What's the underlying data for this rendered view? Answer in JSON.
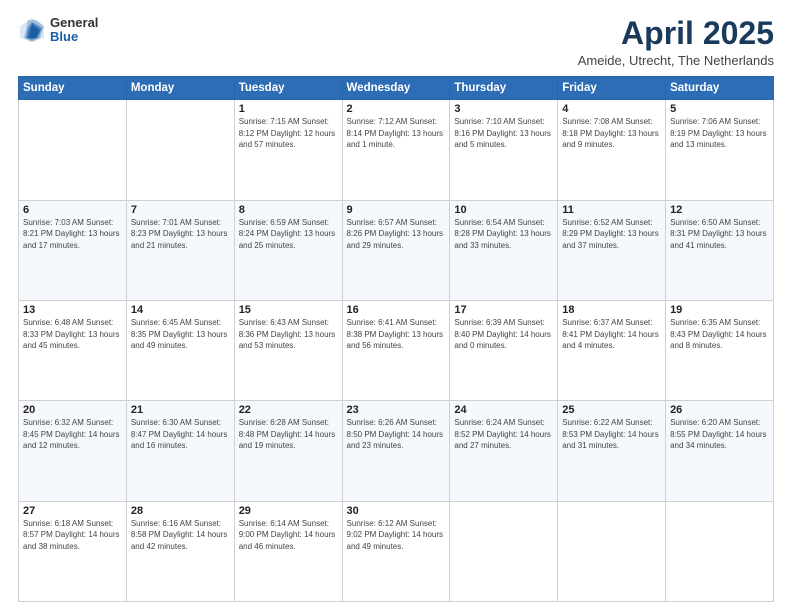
{
  "header": {
    "logo": {
      "general": "General",
      "blue": "Blue"
    },
    "title": "April 2025",
    "location": "Ameide, Utrecht, The Netherlands"
  },
  "days_of_week": [
    "Sunday",
    "Monday",
    "Tuesday",
    "Wednesday",
    "Thursday",
    "Friday",
    "Saturday"
  ],
  "weeks": [
    [
      {
        "day": "",
        "info": ""
      },
      {
        "day": "",
        "info": ""
      },
      {
        "day": "1",
        "info": "Sunrise: 7:15 AM\nSunset: 8:12 PM\nDaylight: 12 hours and 57 minutes."
      },
      {
        "day": "2",
        "info": "Sunrise: 7:12 AM\nSunset: 8:14 PM\nDaylight: 13 hours and 1 minute."
      },
      {
        "day": "3",
        "info": "Sunrise: 7:10 AM\nSunset: 8:16 PM\nDaylight: 13 hours and 5 minutes."
      },
      {
        "day": "4",
        "info": "Sunrise: 7:08 AM\nSunset: 8:18 PM\nDaylight: 13 hours and 9 minutes."
      },
      {
        "day": "5",
        "info": "Sunrise: 7:06 AM\nSunset: 8:19 PM\nDaylight: 13 hours and 13 minutes."
      }
    ],
    [
      {
        "day": "6",
        "info": "Sunrise: 7:03 AM\nSunset: 8:21 PM\nDaylight: 13 hours and 17 minutes."
      },
      {
        "day": "7",
        "info": "Sunrise: 7:01 AM\nSunset: 8:23 PM\nDaylight: 13 hours and 21 minutes."
      },
      {
        "day": "8",
        "info": "Sunrise: 6:59 AM\nSunset: 8:24 PM\nDaylight: 13 hours and 25 minutes."
      },
      {
        "day": "9",
        "info": "Sunrise: 6:57 AM\nSunset: 8:26 PM\nDaylight: 13 hours and 29 minutes."
      },
      {
        "day": "10",
        "info": "Sunrise: 6:54 AM\nSunset: 8:28 PM\nDaylight: 13 hours and 33 minutes."
      },
      {
        "day": "11",
        "info": "Sunrise: 6:52 AM\nSunset: 8:29 PM\nDaylight: 13 hours and 37 minutes."
      },
      {
        "day": "12",
        "info": "Sunrise: 6:50 AM\nSunset: 8:31 PM\nDaylight: 13 hours and 41 minutes."
      }
    ],
    [
      {
        "day": "13",
        "info": "Sunrise: 6:48 AM\nSunset: 8:33 PM\nDaylight: 13 hours and 45 minutes."
      },
      {
        "day": "14",
        "info": "Sunrise: 6:45 AM\nSunset: 8:35 PM\nDaylight: 13 hours and 49 minutes."
      },
      {
        "day": "15",
        "info": "Sunrise: 6:43 AM\nSunset: 8:36 PM\nDaylight: 13 hours and 53 minutes."
      },
      {
        "day": "16",
        "info": "Sunrise: 6:41 AM\nSunset: 8:38 PM\nDaylight: 13 hours and 56 minutes."
      },
      {
        "day": "17",
        "info": "Sunrise: 6:39 AM\nSunset: 8:40 PM\nDaylight: 14 hours and 0 minutes."
      },
      {
        "day": "18",
        "info": "Sunrise: 6:37 AM\nSunset: 8:41 PM\nDaylight: 14 hours and 4 minutes."
      },
      {
        "day": "19",
        "info": "Sunrise: 6:35 AM\nSunset: 8:43 PM\nDaylight: 14 hours and 8 minutes."
      }
    ],
    [
      {
        "day": "20",
        "info": "Sunrise: 6:32 AM\nSunset: 8:45 PM\nDaylight: 14 hours and 12 minutes."
      },
      {
        "day": "21",
        "info": "Sunrise: 6:30 AM\nSunset: 8:47 PM\nDaylight: 14 hours and 16 minutes."
      },
      {
        "day": "22",
        "info": "Sunrise: 6:28 AM\nSunset: 8:48 PM\nDaylight: 14 hours and 19 minutes."
      },
      {
        "day": "23",
        "info": "Sunrise: 6:26 AM\nSunset: 8:50 PM\nDaylight: 14 hours and 23 minutes."
      },
      {
        "day": "24",
        "info": "Sunrise: 6:24 AM\nSunset: 8:52 PM\nDaylight: 14 hours and 27 minutes."
      },
      {
        "day": "25",
        "info": "Sunrise: 6:22 AM\nSunset: 8:53 PM\nDaylight: 14 hours and 31 minutes."
      },
      {
        "day": "26",
        "info": "Sunrise: 6:20 AM\nSunset: 8:55 PM\nDaylight: 14 hours and 34 minutes."
      }
    ],
    [
      {
        "day": "27",
        "info": "Sunrise: 6:18 AM\nSunset: 8:57 PM\nDaylight: 14 hours and 38 minutes."
      },
      {
        "day": "28",
        "info": "Sunrise: 6:16 AM\nSunset: 8:58 PM\nDaylight: 14 hours and 42 minutes."
      },
      {
        "day": "29",
        "info": "Sunrise: 6:14 AM\nSunset: 9:00 PM\nDaylight: 14 hours and 46 minutes."
      },
      {
        "day": "30",
        "info": "Sunrise: 6:12 AM\nSunset: 9:02 PM\nDaylight: 14 hours and 49 minutes."
      },
      {
        "day": "",
        "info": ""
      },
      {
        "day": "",
        "info": ""
      },
      {
        "day": "",
        "info": ""
      }
    ]
  ]
}
